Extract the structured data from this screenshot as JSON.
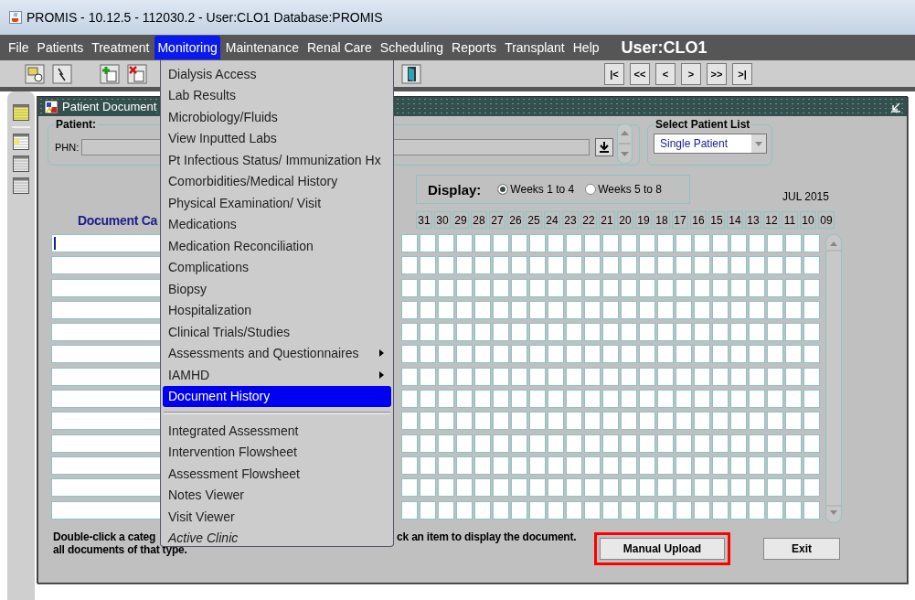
{
  "window": {
    "title": "PROMIS -  10.12.5  - 112030.2 - User:CLO1  Database:PROMIS"
  },
  "menu_bar": {
    "items": [
      {
        "label": "File",
        "selected": false
      },
      {
        "label": "Patients",
        "selected": false
      },
      {
        "label": "Treatment",
        "selected": false
      },
      {
        "label": "Monitoring",
        "selected": true
      },
      {
        "label": "Maintenance",
        "selected": false
      },
      {
        "label": "Renal Care",
        "selected": false
      },
      {
        "label": "Scheduling",
        "selected": false
      },
      {
        "label": "Reports",
        "selected": false
      },
      {
        "label": "Transplant",
        "selected": false
      },
      {
        "label": "Help",
        "selected": false
      }
    ],
    "user": "User:CLO1"
  },
  "toolbar": {
    "nav_buttons": [
      "|<",
      "<<",
      "<",
      ">",
      ">>",
      ">|"
    ]
  },
  "dropdown_menu": {
    "items": [
      {
        "kind": "item",
        "label": "Dialysis Access",
        "selected": false
      },
      {
        "kind": "item",
        "label": "Lab Results",
        "selected": false
      },
      {
        "kind": "item",
        "label": "Microbiology/Fluids",
        "selected": false
      },
      {
        "kind": "item",
        "label": "View Inputted Labs",
        "selected": false
      },
      {
        "kind": "item",
        "label": "Pt Infectious Status/ Immunization Hx",
        "selected": false
      },
      {
        "kind": "item",
        "label": "Comorbidities/Medical History",
        "selected": false
      },
      {
        "kind": "item",
        "label": "Physical Examination/ Visit",
        "selected": false
      },
      {
        "kind": "item",
        "label": "Medications",
        "selected": false
      },
      {
        "kind": "item",
        "label": "Medication Reconciliation",
        "selected": false
      },
      {
        "kind": "item",
        "label": "Complications",
        "selected": false
      },
      {
        "kind": "item",
        "label": "Biopsy",
        "selected": false
      },
      {
        "kind": "item",
        "label": "Hospitalization",
        "selected": false
      },
      {
        "kind": "item",
        "label": "Clinical Trials/Studies",
        "selected": false
      },
      {
        "kind": "submenu",
        "label": "Assessments and Questionnaires",
        "selected": false
      },
      {
        "kind": "submenu",
        "label": "IAMHD",
        "selected": false
      },
      {
        "kind": "item",
        "label": "Document History",
        "selected": true
      },
      {
        "kind": "separator"
      },
      {
        "kind": "item",
        "label": "Integrated Assessment",
        "selected": false
      },
      {
        "kind": "item",
        "label": "Intervention Flowsheet",
        "selected": false
      },
      {
        "kind": "item",
        "label": "Assessment Flowsheet",
        "selected": false
      },
      {
        "kind": "item",
        "label": "Notes Viewer",
        "selected": false
      },
      {
        "kind": "item",
        "label": "Visit Viewer",
        "selected": false
      },
      {
        "kind": "italic",
        "label": "Active Clinic",
        "selected": false
      }
    ]
  },
  "document_window": {
    "title": "Patient Document",
    "patient": {
      "legend": "Patient:",
      "phn_label": "PHN:"
    },
    "patient_list": {
      "legend": "Select Patient List",
      "value": "Single Patient"
    },
    "display": {
      "label": "Display:",
      "options": [
        {
          "label": "Weeks 1 to 4",
          "selected": true
        },
        {
          "label": "Weeks 5 to 8",
          "selected": false
        }
      ]
    },
    "month": "JUL 2015",
    "category_heading": "Document Ca",
    "dates": [
      "31",
      "30",
      "29",
      "28",
      "27",
      "26",
      "25",
      "24",
      "23",
      "22",
      "21",
      "20",
      "19",
      "18",
      "17",
      "16",
      "15",
      "14",
      "13",
      "12",
      "11",
      "10",
      "09"
    ],
    "category_rows": [
      {
        "focused": true
      },
      {
        "focused": false
      },
      {
        "focused": false
      },
      {
        "focused": false
      },
      {
        "focused": false
      },
      {
        "focused": false
      },
      {
        "focused": false
      },
      {
        "focused": false
      },
      {
        "focused": false
      },
      {
        "focused": false
      },
      {
        "focused": false
      },
      {
        "focused": false
      },
      {
        "focused": false
      }
    ],
    "hint_left": "Double-click a categ",
    "hint_right": "ck an item to display the document.",
    "hint_second": "all documents of that type.",
    "buttons": [
      {
        "label": "Manual Upload",
        "highlighted": true
      },
      {
        "label": "Exit",
        "highlighted": false
      }
    ]
  }
}
